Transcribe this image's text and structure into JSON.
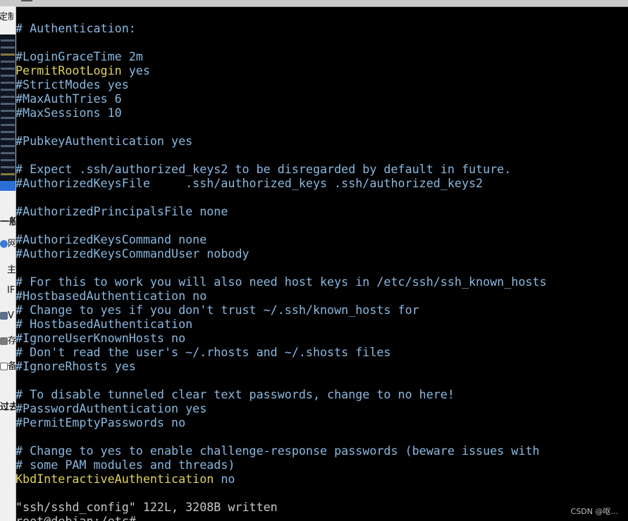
{
  "sidebar": {
    "top_label": "定制",
    "section_1": "一般",
    "item_1": "网",
    "item_2": "主",
    "item_3": "IF",
    "item_4": "V",
    "item_5": "存",
    "item_6": "备",
    "section_2": "过去"
  },
  "terminal": {
    "lines": [
      {
        "text": "# Authentication:",
        "style": "comment"
      },
      {
        "text": "",
        "style": "comment"
      },
      {
        "text": "#LoginGraceTime 2m",
        "style": "comment"
      },
      {
        "key": "PermitRootLogin",
        "val": " yes",
        "style": "kw"
      },
      {
        "text": "#StrictModes yes",
        "style": "comment"
      },
      {
        "text": "#MaxAuthTries 6",
        "style": "comment"
      },
      {
        "text": "#MaxSessions 10",
        "style": "comment"
      },
      {
        "text": "",
        "style": "comment"
      },
      {
        "text": "#PubkeyAuthentication yes",
        "style": "comment"
      },
      {
        "text": "",
        "style": "comment"
      },
      {
        "text": "# Expect .ssh/authorized_keys2 to be disregarded by default in future.",
        "style": "comment"
      },
      {
        "text": "#AuthorizedKeysFile     .ssh/authorized_keys .ssh/authorized_keys2",
        "style": "comment"
      },
      {
        "text": "",
        "style": "comment"
      },
      {
        "text": "#AuthorizedPrincipalsFile none",
        "style": "comment"
      },
      {
        "text": "",
        "style": "comment"
      },
      {
        "text": "#AuthorizedKeysCommand none",
        "style": "comment"
      },
      {
        "text": "#AuthorizedKeysCommandUser nobody",
        "style": "comment"
      },
      {
        "text": "",
        "style": "comment"
      },
      {
        "text": "# For this to work you will also need host keys in /etc/ssh/ssh_known_hosts",
        "style": "comment"
      },
      {
        "text": "#HostbasedAuthentication no",
        "style": "comment"
      },
      {
        "text": "# Change to yes if you don't trust ~/.ssh/known_hosts for",
        "style": "comment"
      },
      {
        "text": "# HostbasedAuthentication",
        "style": "comment"
      },
      {
        "text": "#IgnoreUserKnownHosts no",
        "style": "comment"
      },
      {
        "text": "# Don't read the user's ~/.rhosts and ~/.shosts files",
        "style": "comment"
      },
      {
        "text": "#IgnoreRhosts yes",
        "style": "comment"
      },
      {
        "text": "",
        "style": "comment"
      },
      {
        "text": "# To disable tunneled clear text passwords, change to no here!",
        "style": "comment"
      },
      {
        "text": "#PasswordAuthentication yes",
        "style": "comment"
      },
      {
        "text": "#PermitEmptyPasswords no",
        "style": "comment"
      },
      {
        "text": "",
        "style": "comment"
      },
      {
        "text": "# Change to yes to enable challenge-response passwords (beware issues with",
        "style": "comment"
      },
      {
        "text": "# some PAM modules and threads)",
        "style": "comment"
      },
      {
        "key": "KbdInteractiveAuthentication",
        "val": " no",
        "style": "kw"
      },
      {
        "text": "",
        "style": "comment"
      },
      {
        "text": "\"ssh/sshd_config\" 122L, 3208B written",
        "style": "plain"
      },
      {
        "text": "root@debian:/etc#",
        "style": "prompt"
      }
    ]
  },
  "watermark": "CSDN @呕..."
}
